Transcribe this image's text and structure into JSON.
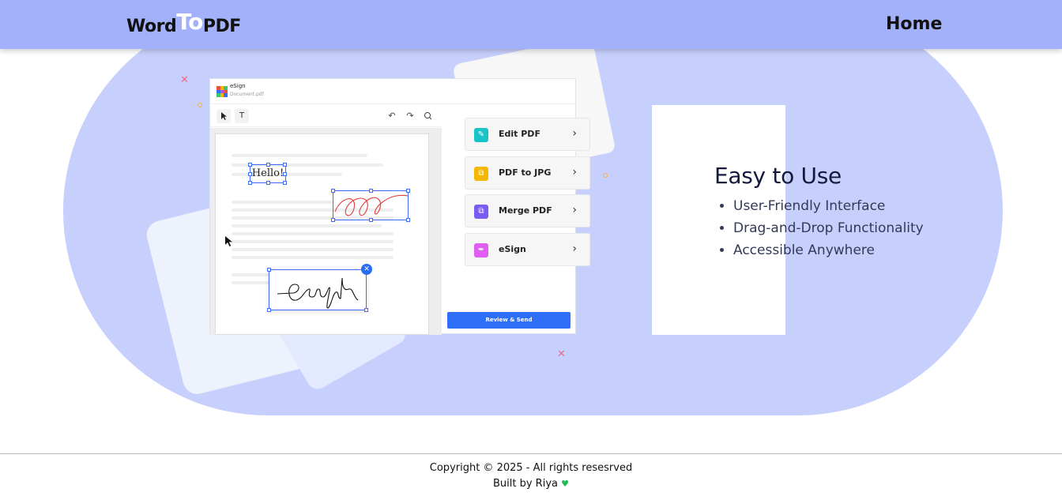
{
  "navbar": {
    "logo_left": "Word",
    "logo_mid": "To",
    "logo_right": "PDF",
    "home_label": "Home"
  },
  "preview": {
    "app_title": "eSign",
    "app_subtitle": "Document.pdf",
    "hello_text": "Hello!",
    "menu": [
      {
        "label": "Edit PDF",
        "icon": "edit-icon",
        "color": "#19c3c8"
      },
      {
        "label": "PDF to JPG",
        "icon": "image-convert-icon",
        "color": "#f5b800"
      },
      {
        "label": "Merge PDF",
        "icon": "merge-icon",
        "color": "#7b5cf2"
      },
      {
        "label": "eSign",
        "icon": "pen-icon",
        "color": "#e05ff0"
      }
    ],
    "review_button": "Review & Send"
  },
  "features": {
    "title": "Easy to Use",
    "items": [
      "User-Friendly Interface",
      "Drag-and-Drop Functionality",
      "Accessible Anywhere"
    ]
  },
  "footer": {
    "copyright": "Copyright © 2025 - All rights resesrved",
    "built_by": "Built by Riya",
    "heart": "♥"
  },
  "colors": {
    "navbar_bg": "#a3b1fb",
    "hero_bg": "#c7d0fd",
    "accent_blue": "#2f6ff7",
    "heart_green": "#1db954"
  }
}
